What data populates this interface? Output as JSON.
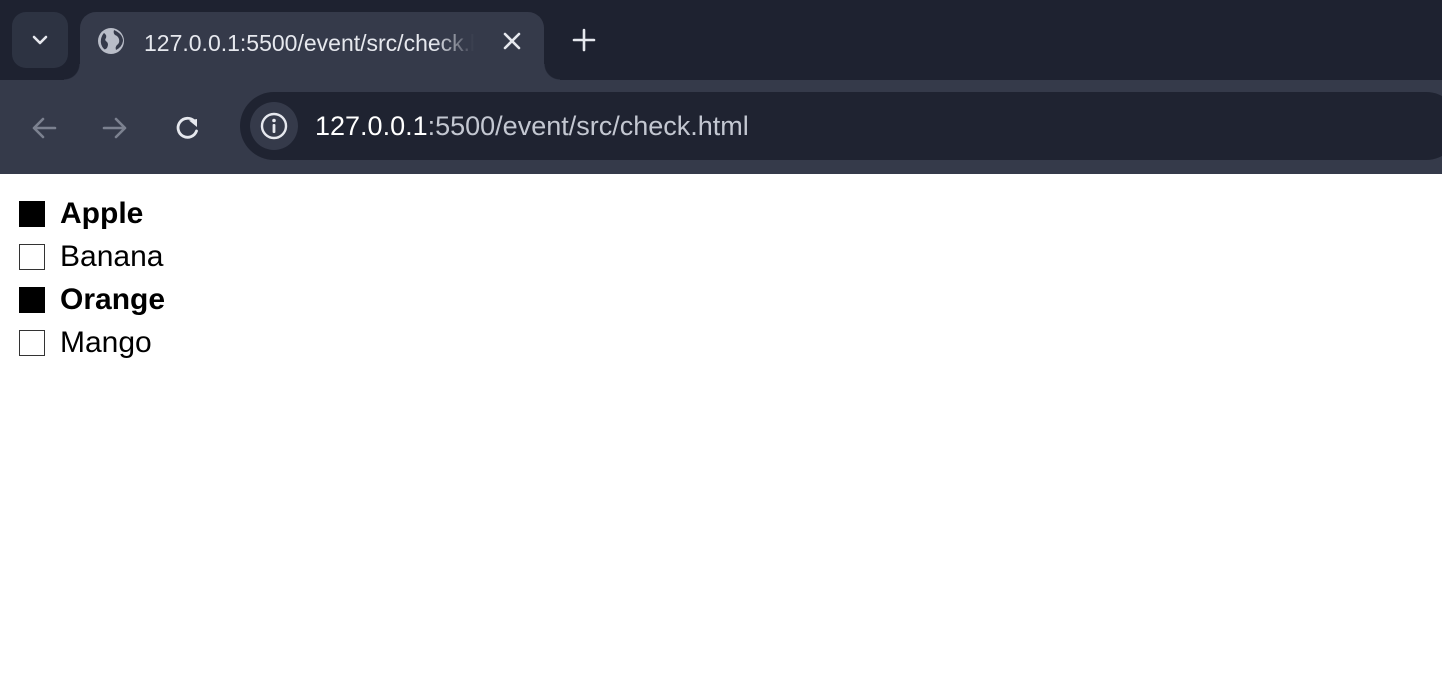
{
  "browser": {
    "tab": {
      "title": "127.0.0.1:5500/event/src/check.html"
    },
    "url": {
      "host": "127.0.0.1",
      "path": ":5500/event/src/check.html"
    },
    "icons": {
      "tab_search": "chevron-down-icon",
      "favicon": "globe-icon",
      "close": "close-icon",
      "new_tab": "plus-icon",
      "back": "arrow-left-icon",
      "forward": "arrow-right-icon",
      "reload": "reload-icon",
      "site_info": "info-icon"
    },
    "colors": {
      "tabstrip": "#1e2230",
      "toolbar": "#353a4a",
      "omnibox": "#1f2331"
    }
  },
  "checklist": {
    "items": [
      {
        "label": "Apple",
        "checked": true
      },
      {
        "label": "Banana",
        "checked": false
      },
      {
        "label": "Orange",
        "checked": true
      },
      {
        "label": "Mango",
        "checked": false
      }
    ]
  }
}
